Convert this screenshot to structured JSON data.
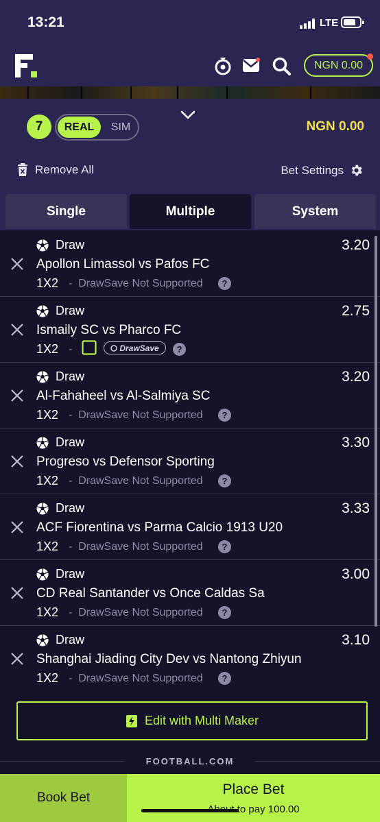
{
  "status_bar": {
    "time": "13:21",
    "network": "LTE"
  },
  "header": {
    "ngn_pill": "NGN 0.00",
    "icons": [
      "logo-icon",
      "wheel-icon",
      "mail-icon",
      "search-icon"
    ]
  },
  "betslip": {
    "selection_count": "7",
    "mode_real": "REAL",
    "mode_sim": "SIM",
    "balance": "NGN 0.00",
    "remove_all": "Remove All",
    "bet_settings": "Bet Settings",
    "tabs": [
      {
        "label": "Single"
      },
      {
        "label": "Multiple",
        "active": true
      },
      {
        "label": "System"
      }
    ]
  },
  "selections": [
    {
      "outcome": "Draw",
      "odds": "3.20",
      "match": "Apollon Limassol vs Pafos FC",
      "market": "1X2",
      "drawsave": "DrawSave Not Supported"
    },
    {
      "outcome": "Draw",
      "odds": "2.75",
      "match": "Ismaily SC vs Pharco FC",
      "market": "1X2",
      "drawsave_badge": "DrawSave"
    },
    {
      "outcome": "Draw",
      "odds": "3.20",
      "match": "Al-Fahaheel vs Al-Salmiya SC",
      "market": "1X2",
      "drawsave": "DrawSave Not Supported"
    },
    {
      "outcome": "Draw",
      "odds": "3.30",
      "match": "Progreso vs Defensor Sporting",
      "market": "1X2",
      "drawsave": "DrawSave Not Supported"
    },
    {
      "outcome": "Draw",
      "odds": "3.33",
      "match": "ACF Fiorentina vs Parma Calcio 1913 U20",
      "market": "1X2",
      "drawsave": "DrawSave Not Supported"
    },
    {
      "outcome": "Draw",
      "odds": "3.00",
      "match": "CD Real Santander vs Once Caldas Sa",
      "market": "1X2",
      "drawsave": "DrawSave Not Supported"
    },
    {
      "outcome": "Draw",
      "odds": "3.10",
      "match": "Shanghai Jiading City Dev vs Nantong Zhiyun",
      "market": "1X2",
      "drawsave": "DrawSave Not Supported"
    }
  ],
  "dash": "-",
  "help": "?",
  "multi_maker": "Edit with Multi Maker",
  "brand": "FOOTBALL.COM",
  "footer": {
    "book_bet": "Book Bet",
    "place_bet": "Place Bet",
    "place_sub": "About to pay 100.00"
  },
  "colors": {
    "accent": "#b6f24a",
    "balance": "#f2e34a",
    "bg": "#15132a",
    "header_bg": "#2b2651"
  }
}
